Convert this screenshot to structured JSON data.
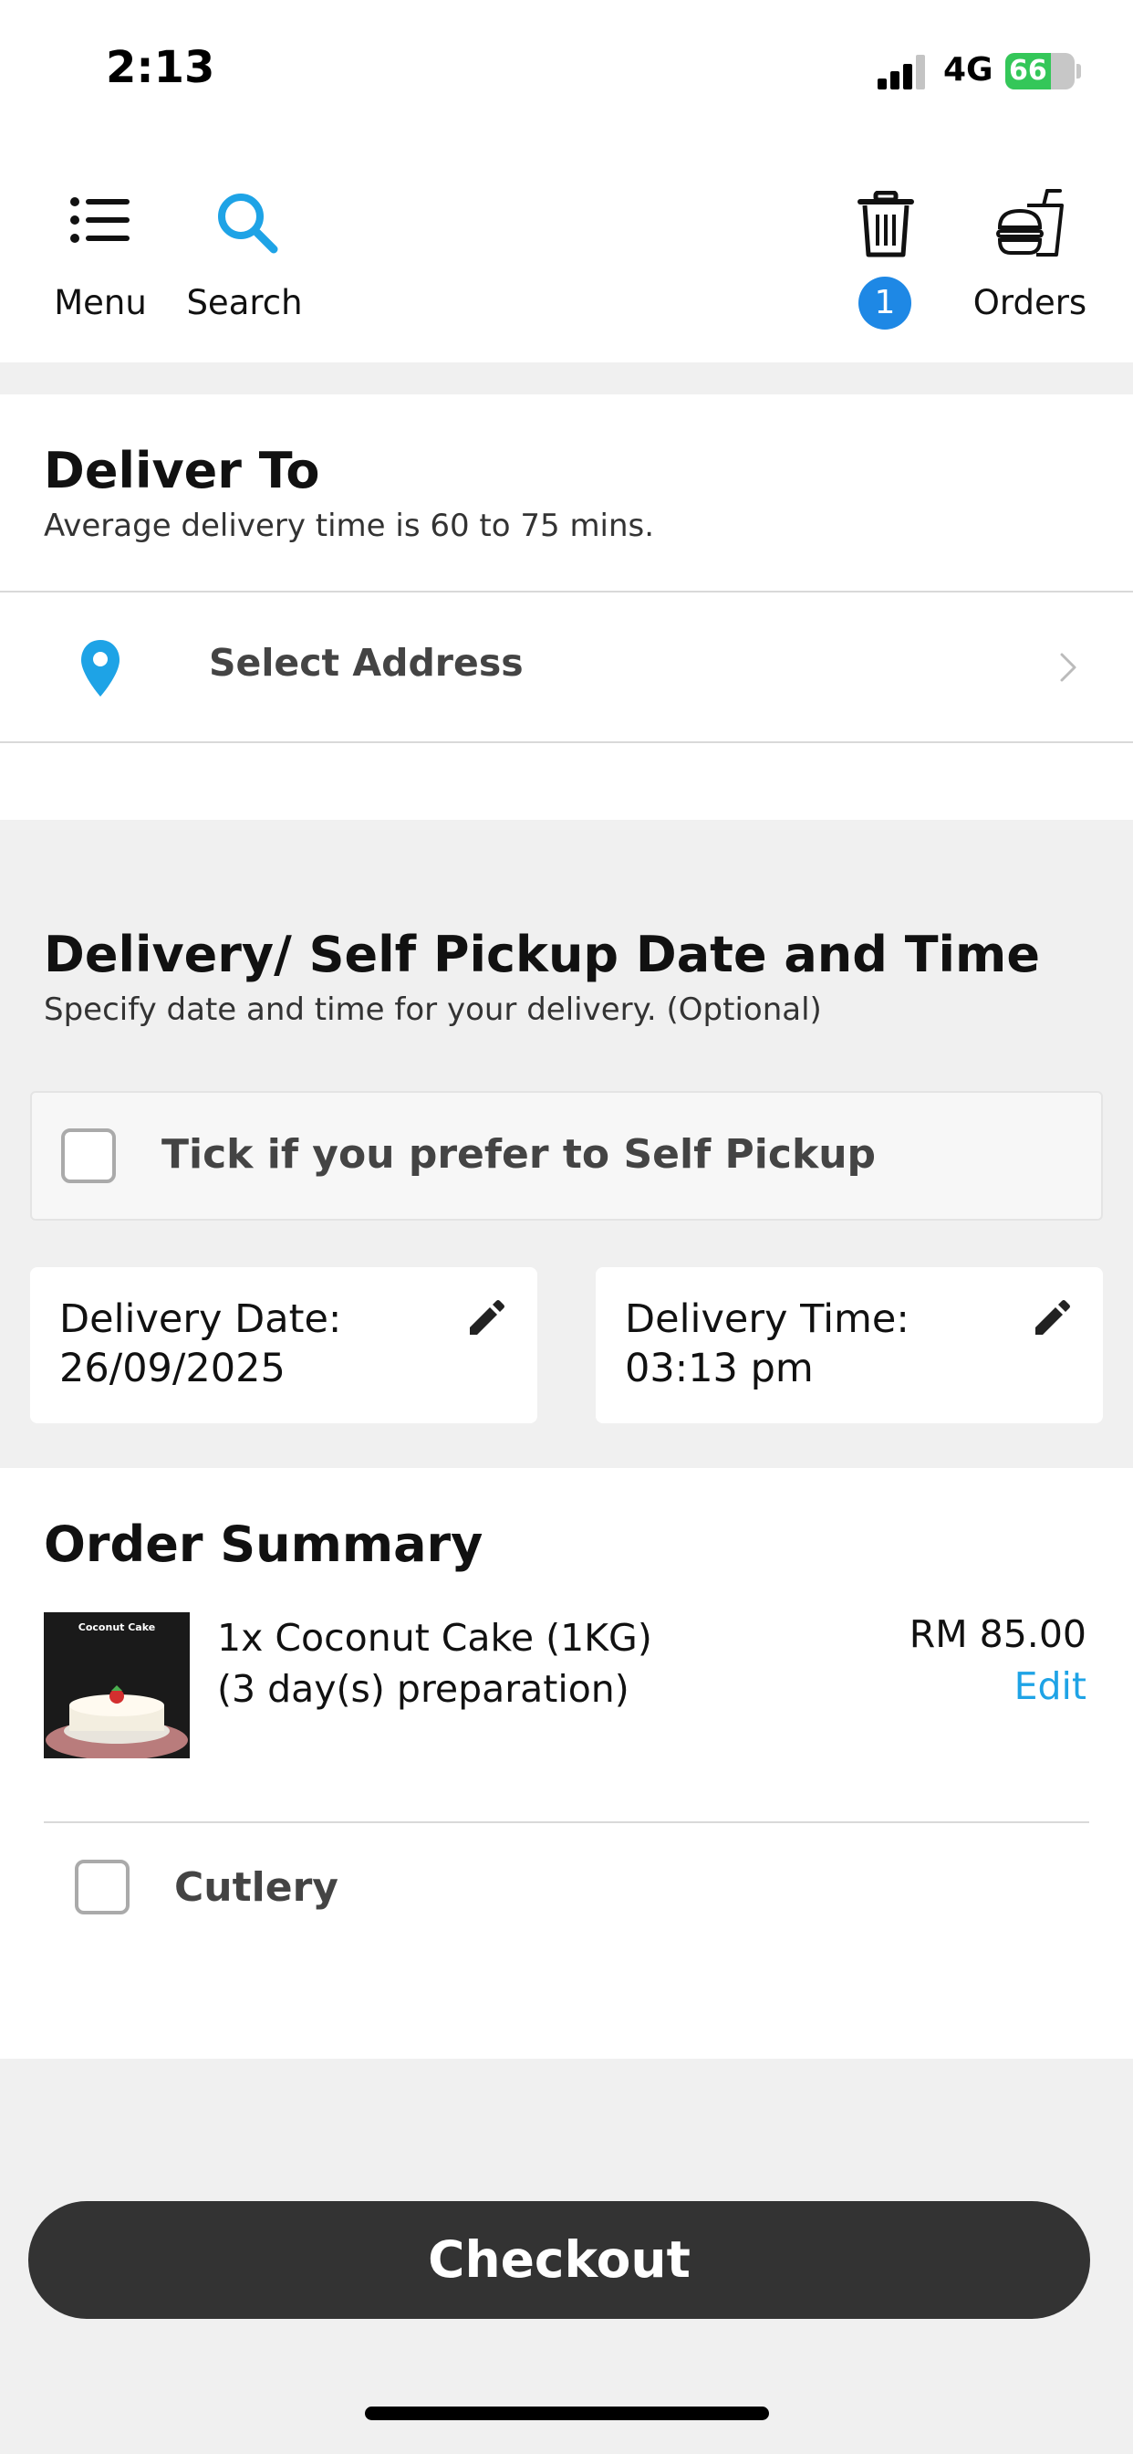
{
  "status_bar": {
    "time": "2:13",
    "network": "4G",
    "battery": "66",
    "battery_level": 0.66,
    "signal_bars_active": 3
  },
  "nav": {
    "menu_label": "Menu",
    "search_label": "Search",
    "cart_badge": "1",
    "orders_label": "Orders",
    "menu_icon": "list-icon",
    "search_icon": "search-icon",
    "cart_icon": "trash-bin-icon",
    "orders_icon": "burger-drink-icon"
  },
  "deliver_to": {
    "title": "Deliver To",
    "subtitle": "Average delivery time is 60 to 75 mins.",
    "address_label": "Select Address"
  },
  "schedule": {
    "title": "Delivery/ Self Pickup Date and Time",
    "subtitle": "Specify date and time for your delivery. (Optional)",
    "self_pickup_label": "Tick if you prefer to Self Pickup",
    "self_pickup_checked": false,
    "date_label": "Delivery Date:",
    "date_value": "26/09/2025",
    "time_label": "Delivery Time:",
    "time_value": "03:13 pm"
  },
  "order_summary": {
    "title": "Order Summary",
    "items": [
      {
        "name": "1x Coconut Cake (1KG)",
        "note": "(3 day(s) preparation)",
        "price": "RM 85.00",
        "edit_label": "Edit",
        "image_caption": "Coconut Cake"
      }
    ],
    "cutlery_label": "Cutlery",
    "cutlery_checked": false
  },
  "checkout_label": "Checkout",
  "colors": {
    "accent_blue": "#1ea3e6",
    "badge_blue": "#1e88e5",
    "button_dark": "#333333",
    "battery_green": "#34c759"
  }
}
